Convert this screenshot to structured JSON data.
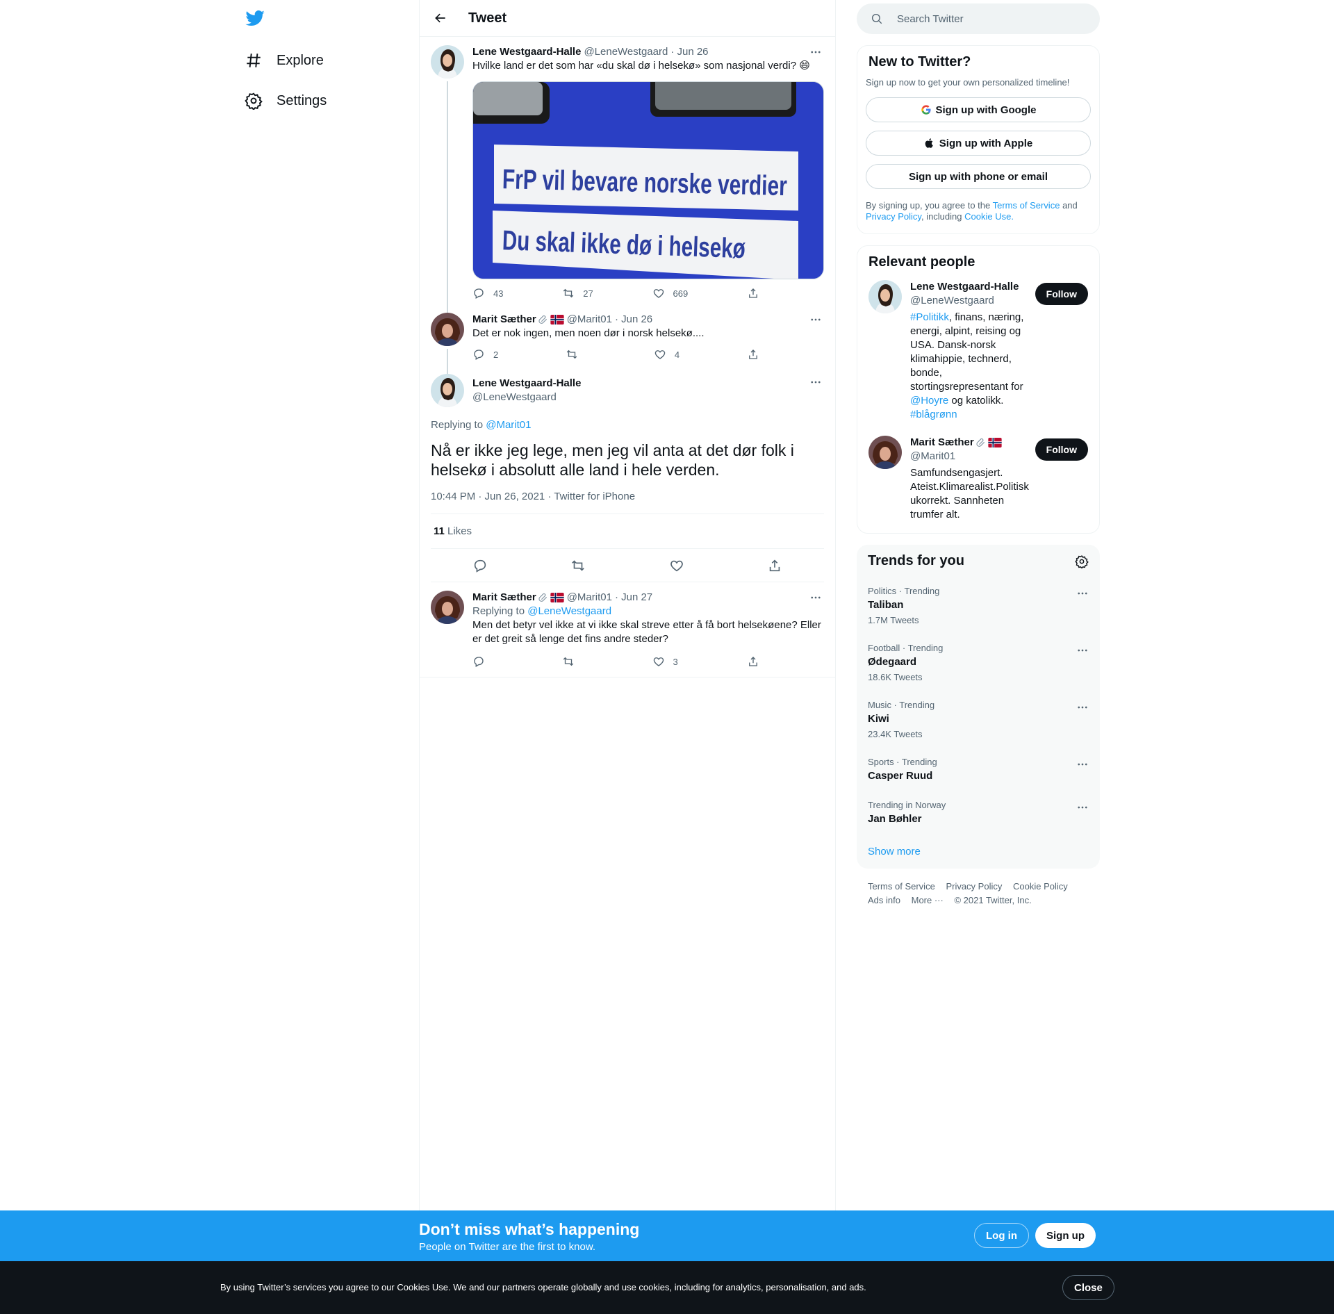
{
  "nav": {
    "explore": "Explore",
    "settings": "Settings"
  },
  "header": {
    "title": "Tweet"
  },
  "thread": {
    "t1": {
      "name": "Lene Westgaard-Halle",
      "handle": "@LeneWestgaard",
      "date": "· Jun 26",
      "text": "Hvilke land er det som har «du skal dø i helsekø» som nasjonal verdi? 😄",
      "image_line1": "FrP vil bevare norske verdier",
      "image_line2": "Du skal ikke dø i helsekø",
      "replies": "43",
      "retweets": "27",
      "likes": "669"
    },
    "t2": {
      "name": "Marit Sæther",
      "handle": "@Marit01",
      "date": "· Jun 26",
      "text": "Det er nok ingen, men noen dør i norsk helsekø....",
      "replies": "2",
      "likes": "4"
    },
    "focus": {
      "name": "Lene Westgaard-Halle",
      "handle": "@LeneWestgaard",
      "replying_prefix": "Replying to",
      "replying_to": "@Marit01",
      "text": "Nå er ikke jeg lege, men jeg vil anta at det dør folk i helsekø i absolutt alle land i hele verden.",
      "timestamp": "10:44 PM · Jun 26, 2021 · Twitter for iPhone",
      "likes_count": "11",
      "likes_label": "Likes"
    },
    "t4": {
      "name": "Marit Sæther",
      "handle": "@Marit01",
      "date": "· Jun 27",
      "replying_prefix": "Replying to",
      "replying_to": "@LeneWestgaard",
      "text": "Men det betyr vel ikke at vi ikke skal streve etter å få bort helsekøene? Eller er det greit så lenge det fins andre steder?",
      "likes": "3"
    }
  },
  "search": {
    "placeholder": "Search Twitter"
  },
  "new_to_twitter": {
    "title": "New to Twitter?",
    "subtitle": "Sign up now to get your own personalized timeline!",
    "google": "Sign up with Google",
    "apple": "Sign up with Apple",
    "phone": "Sign up with phone or email",
    "legal_1": "By signing up, you agree to the",
    "tos": "Terms of Service",
    "legal_2": "and",
    "privacy": "Privacy Policy",
    "legal_3": ", including",
    "cookie": "Cookie Use."
  },
  "relevant": {
    "title": "Relevant people",
    "follow": "Follow",
    "p1": {
      "name": "Lene Westgaard-Halle",
      "handle": "@LeneWestgaard",
      "bio_tag1": "#Politikk",
      "bio_1": ", finans, næring, energi, alpint, reising og USA. Dansk-norsk klimahippie, technerd, bonde, stortingsrepresentant for",
      "bio_mention": "@Hoyre",
      "bio_2": "og katolikk.",
      "bio_tag2": "#blågrønn"
    },
    "p2": {
      "name": "Marit Sæther",
      "handle": "@Marit01",
      "bio": "Samfundsengasjert. Ateist.Klimarealist.Politisk ukorrekt. Sannheten trumfer alt."
    }
  },
  "trends": {
    "title": "Trends for you",
    "items": [
      {
        "context": "Politics · Trending",
        "topic": "Taliban",
        "count": "1.7M Tweets"
      },
      {
        "context": "Football · Trending",
        "topic": "Ødegaard",
        "count": "18.6K Tweets"
      },
      {
        "context": "Music · Trending",
        "topic": "Kiwi",
        "count": "23.4K Tweets"
      },
      {
        "context": "Sports · Trending",
        "topic": "Casper Ruud",
        "count": ""
      },
      {
        "context": "Trending in Norway",
        "topic": "Jan Bøhler",
        "count": ""
      }
    ],
    "show_more": "Show more"
  },
  "footer": {
    "tos": "Terms of Service",
    "privacy": "Privacy Policy",
    "cookie": "Cookie Policy",
    "ads": "Ads info",
    "more": "More ···",
    "copyright": "© 2021 Twitter, Inc."
  },
  "signup_bar": {
    "title": "Don’t miss what’s happening",
    "subtitle": "People on Twitter are the first to know.",
    "login": "Log in",
    "signup": "Sign up"
  },
  "cookie_bar": {
    "message": "By using Twitter’s services you agree to our Cookies Use. We and our partners operate globally and use cookies, including for analytics, personalisation, and ads.",
    "close": "Close"
  },
  "colors": {
    "accent": "#1d9bf0",
    "text": "#0f1419",
    "muted": "#536471"
  }
}
